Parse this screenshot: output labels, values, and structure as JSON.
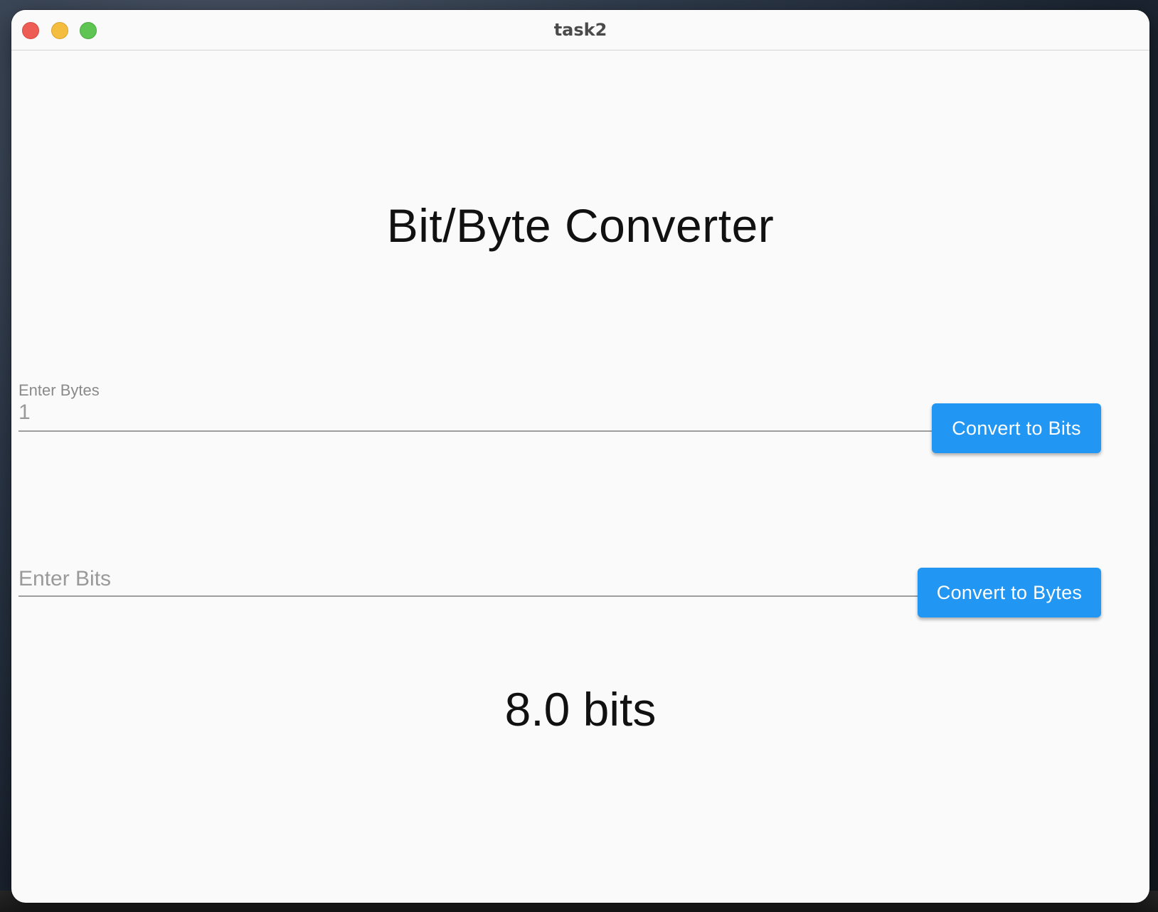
{
  "window": {
    "title": "task2"
  },
  "app": {
    "heading": "Bit/Byte Converter",
    "bytes_field": {
      "label": "Enter Bytes",
      "value": "1"
    },
    "convert_to_bits_button": "Convert to Bits",
    "bits_field": {
      "placeholder": "Enter Bits",
      "value": ""
    },
    "convert_to_bytes_button": "Convert to Bytes",
    "result": "8.0 bits"
  },
  "colors": {
    "button": "#2196f3",
    "background": "#fafafa",
    "close": "#ee5d55",
    "minimize": "#f5bd3f",
    "maximize": "#5fc552"
  }
}
